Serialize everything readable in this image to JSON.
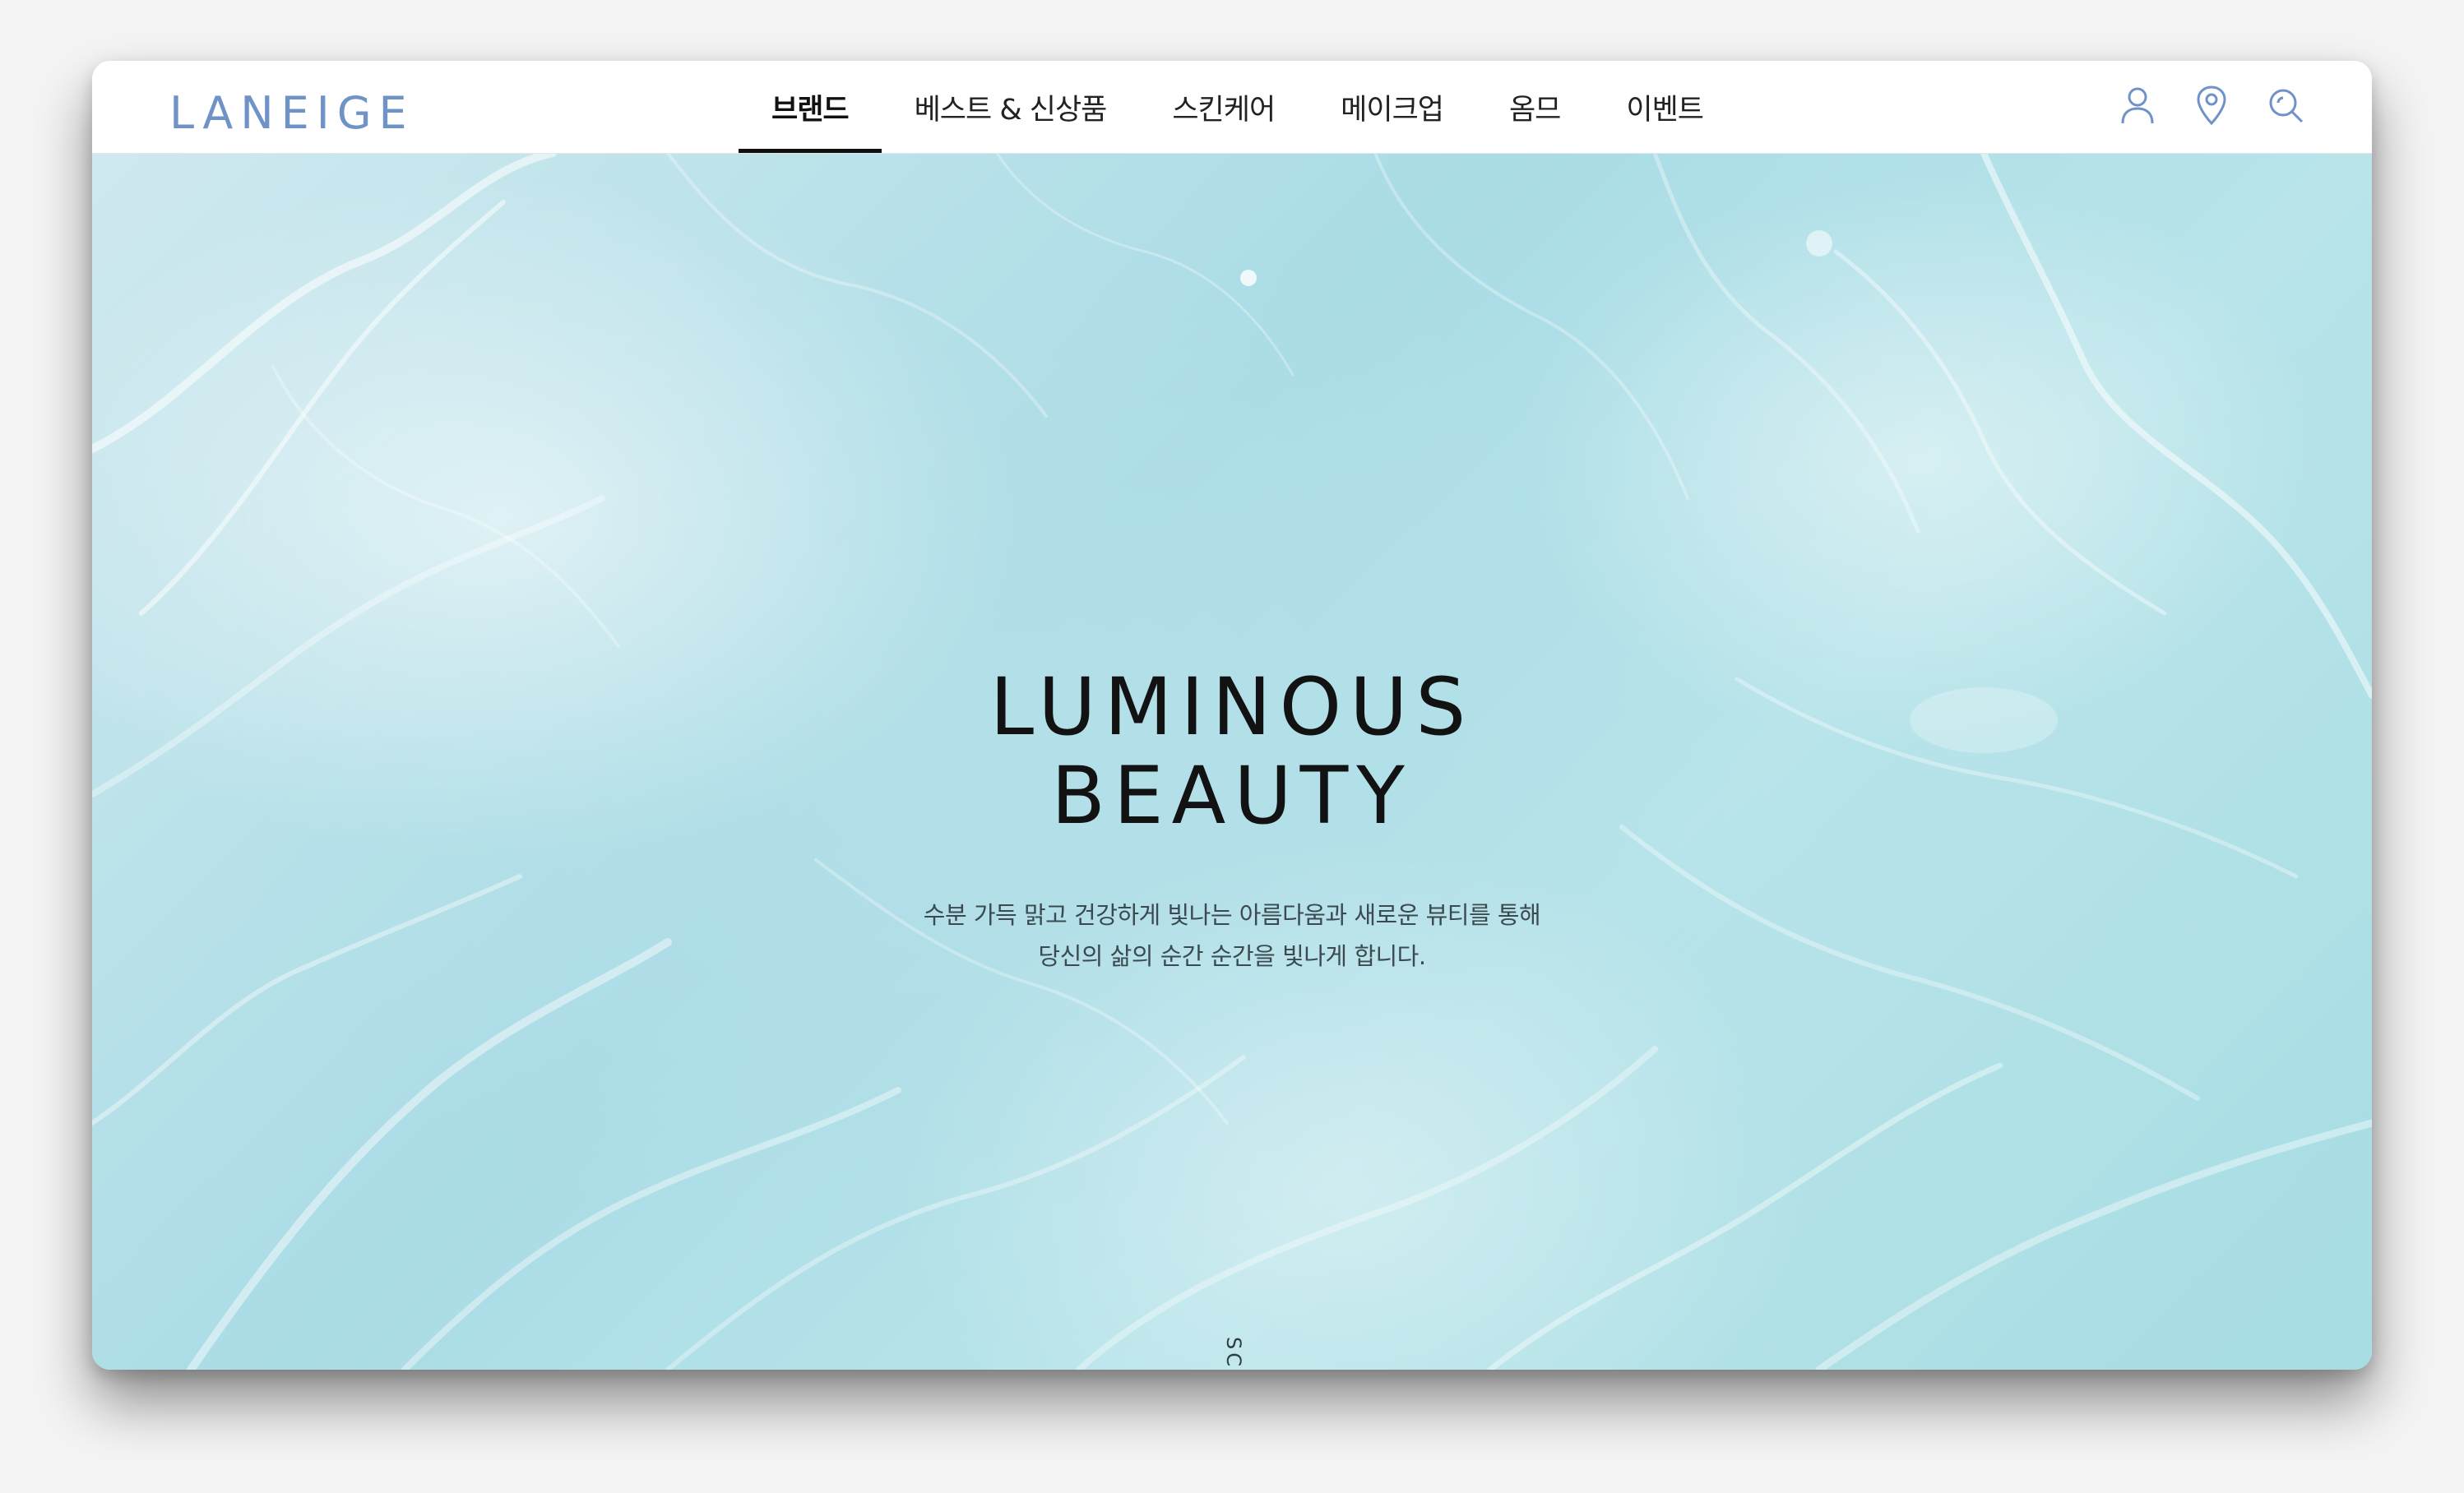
{
  "brand": {
    "logo_text": "LANEIGE",
    "logo_color": "#6f92c7"
  },
  "nav": {
    "items": [
      {
        "label": "브랜드",
        "active": true
      },
      {
        "label": "베스트 & 신상품",
        "active": false
      },
      {
        "label": "스킨케어",
        "active": false
      },
      {
        "label": "메이크업",
        "active": false
      },
      {
        "label": "옴므",
        "active": false
      },
      {
        "label": "이벤트",
        "active": false
      }
    ],
    "icons": [
      "user-icon",
      "location-pin-icon",
      "search-icon"
    ],
    "icon_color": "#6f92c7"
  },
  "hero": {
    "title_line1": "LUMINOUS",
    "title_line2": "BEAUTY",
    "subtitle_line1": "수분 가득 맑고 건강하게 빛나는 아름다움과 새로운 뷰티를 통해",
    "subtitle_line2": "당신의 삶의 순간 순간을 빛나게 합니다.",
    "scroll_label": "SCROLL"
  }
}
